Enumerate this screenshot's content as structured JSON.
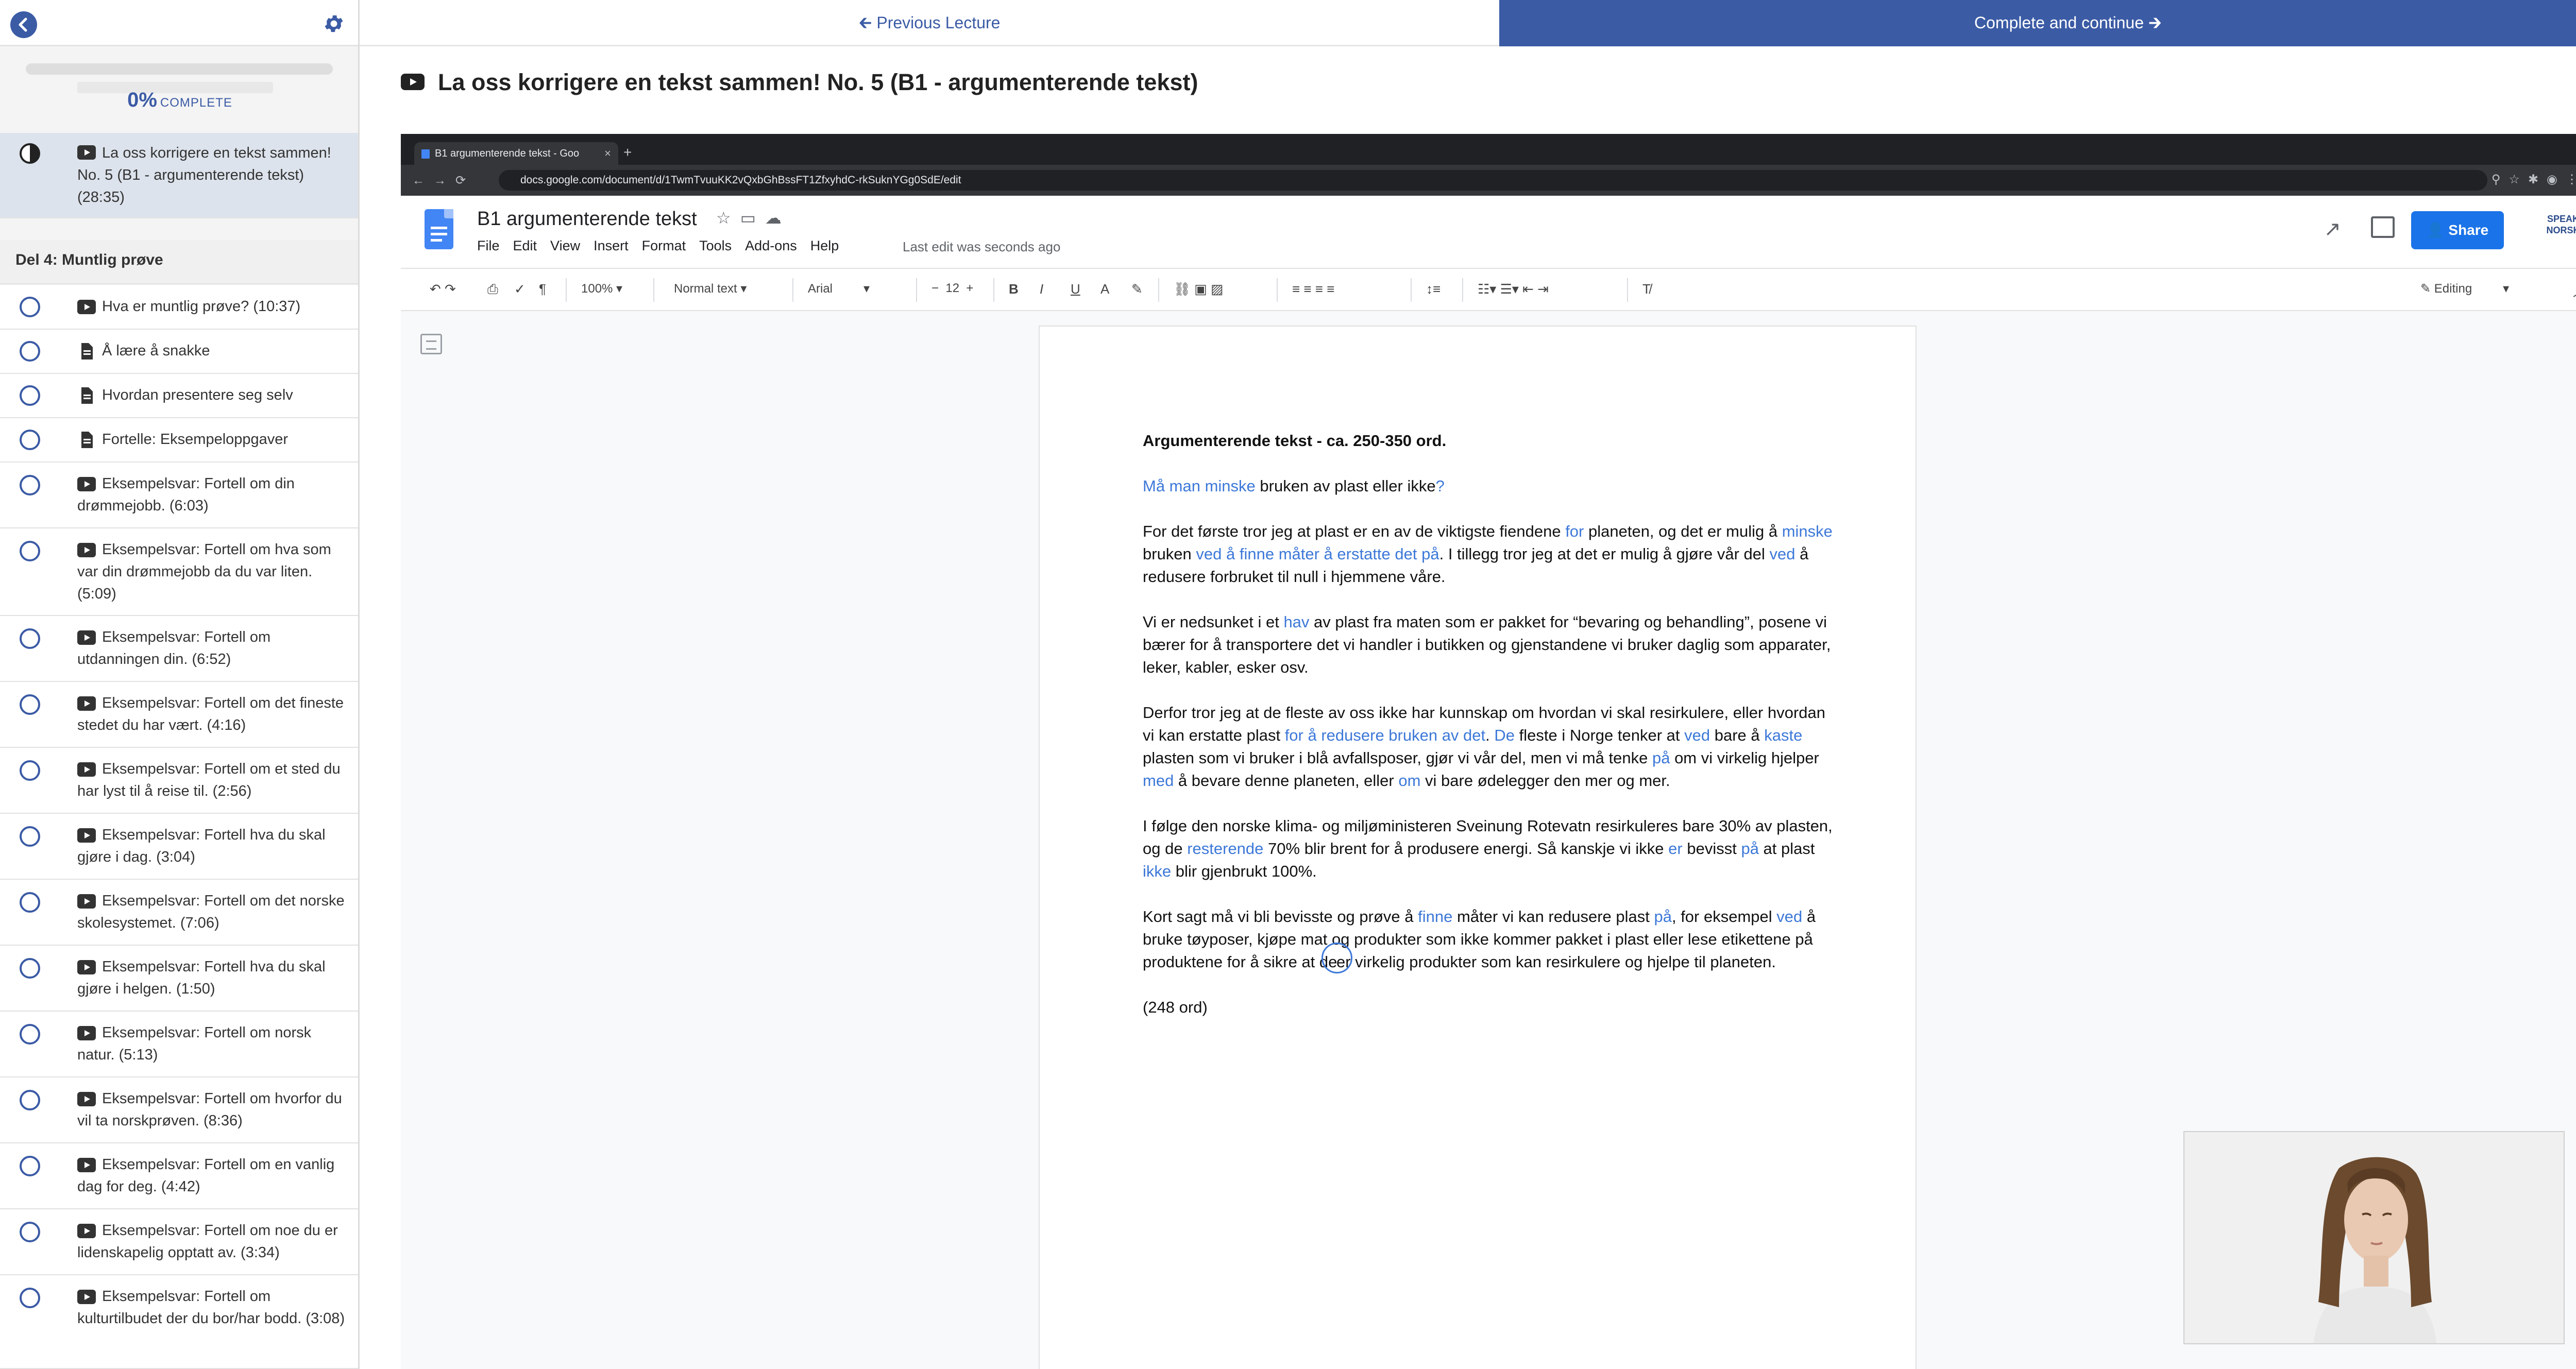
{
  "sidebar": {
    "progress_percent": 0,
    "progress_pct_text": "0%",
    "progress_complete_label": "COMPLETE",
    "current_item": {
      "label": "La oss korrigere en tekst sammen! No. 5 (B1 - argumenterende tekst) (28:35)",
      "icon": "video-icon"
    },
    "section_title": "Del 4: Muntlig prøve",
    "items": [
      {
        "label": "Hva er muntlig prøve? (10:37)",
        "icon": "video-icon"
      },
      {
        "label": "Å lære å snakke",
        "icon": "document-icon"
      },
      {
        "label": "Hvordan presentere seg selv",
        "icon": "document-icon"
      },
      {
        "label": "Fortelle: Eksempeloppgaver",
        "icon": "document-icon"
      },
      {
        "label": "Eksempelsvar: Fortell om din drømmejobb. (6:03)",
        "icon": "video-icon"
      },
      {
        "label": "Eksempelsvar: Fortell om hva som var din drømmejobb da du var liten. (5:09)",
        "icon": "video-icon"
      },
      {
        "label": "Eksempelsvar: Fortell om utdanningen din. (6:52)",
        "icon": "video-icon"
      },
      {
        "label": "Eksempelsvar: Fortell om det fineste stedet du har vært. (4:16)",
        "icon": "video-icon"
      },
      {
        "label": "Eksempelsvar: Fortell om et sted du har lyst til å reise til. (2:56)",
        "icon": "video-icon"
      },
      {
        "label": "Eksempelsvar: Fortell hva du skal gjøre i dag. (3:04)",
        "icon": "video-icon"
      },
      {
        "label": "Eksempelsvar: Fortell om det norske skolesystemet. (7:06)",
        "icon": "video-icon"
      },
      {
        "label": "Eksempelsvar: Fortell hva du skal gjøre i helgen. (1:50)",
        "icon": "video-icon"
      },
      {
        "label": "Eksempelsvar: Fortell om norsk natur. (5:13)",
        "icon": "video-icon"
      },
      {
        "label": "Eksempelsvar: Fortell om hvorfor du vil ta norskprøven. (8:36)",
        "icon": "video-icon"
      },
      {
        "label": "Eksempelsvar: Fortell om en vanlig dag for deg. (4:42)",
        "icon": "video-icon"
      },
      {
        "label": "Eksempelsvar: Fortell om noe du er lidenskapelig opptatt av. (3:34)",
        "icon": "video-icon"
      },
      {
        "label": "Eksempelsvar: Fortell om kulturtilbudet der du bor/har bodd. (3:08)",
        "icon": "video-icon"
      }
    ]
  },
  "topbar": {
    "prev_label": "Previous Lecture",
    "next_label": "Complete and continue"
  },
  "lecture": {
    "title": "La oss korrigere en tekst sammen! No. 5 (B1 - argumenterende tekst)"
  },
  "video": {
    "browser": {
      "tab_title": "B1 argumenterende tekst - Goo",
      "url": "docs.google.com/document/d/1TwmTvuuKK2vQxbGhBssFT1ZfxyhdC-rkSuknYGg0SdE/edit"
    },
    "docs": {
      "doc_title": "B1 argumenterende tekst",
      "menus": [
        "File",
        "Edit",
        "View",
        "Insert",
        "Format",
        "Tools",
        "Add-ons",
        "Help"
      ],
      "last_edit": "Last edit was seconds ago",
      "share_label": "Share",
      "avatar_text_1": "SPEAK",
      "avatar_text_2": "NORSK",
      "toolbar": {
        "zoom": "100%",
        "style": "Normal text",
        "font": "Arial",
        "font_size": "12",
        "mode": "Editing"
      }
    },
    "document": {
      "heading": "Argumenterende tekst - ca. 250-350 ord.",
      "question_blue": "Må man minske",
      "question_rest": " bruken av plast eller ikke",
      "question_mark": "?",
      "p1_a": "For det første tror jeg at plast er en av de viktigste fiendene ",
      "p1_b": "for",
      "p1_c": " planeten, og det er mulig å ",
      "p1_d": "minske",
      "p1_e": " bruken ",
      "p1_f": "ved å finne måter å erstatte det på",
      "p1_g": ". I tillegg tror jeg at det er mulig å gjøre vår del ",
      "p1_h": "ved",
      "p1_i": " å redusere forbruket til null i hjemmene våre.",
      "p2_a": "Vi er nedsunket i et ",
      "p2_b": "hav",
      "p2_c": " av plast fra maten som er pakket for “bevaring og behandling”, posene vi bærer for å transportere det vi handler i butikken og gjenstandene vi bruker daglig som apparater, leker, kabler, esker osv.",
      "p3_a": "Derfor tror jeg at de fleste av oss ikke har kunnskap om hvordan vi skal resirkulere, eller hvordan vi kan erstatte plast ",
      "p3_b": "for å redusere bruken av det",
      "p3_c": ". ",
      "p3_d": "De",
      "p3_e": " fleste i Norge tenker at ",
      "p3_f": "ved",
      "p3_g": " bare å ",
      "p3_h": "kaste",
      "p3_i": " plasten som vi bruker i blå avfallsposer, gjør vi vår del, men vi må tenke ",
      "p3_j": "på",
      "p3_k": " om vi virkelig hjelper ",
      "p3_l": "med",
      "p3_m": " å bevare denne planeten, eller ",
      "p3_n": "om",
      "p3_o": " vi bare ødelegger den mer og mer.",
      "p4_a": "I følge den norske klima- og miljøministeren Sveinung Rotevatn resirkuleres bare 30% av plasten, og de ",
      "p4_b": "resterende",
      "p4_c": " 70% blir brent for å produsere energi. Så kanskje vi ikke ",
      "p4_d": "er",
      "p4_e": " bevisst ",
      "p4_f": "på",
      "p4_g": " at plast ",
      "p4_h": "ikke",
      "p4_i": " blir gjenbrukt 100%.",
      "p5_a": "Kort sagt må vi bli bevisste og prøve å ",
      "p5_b": "finne",
      "p5_c": " måter vi kan redusere plast ",
      "p5_d": "på",
      "p5_e": ", for eksempel ",
      "p5_f": "ved",
      "p5_g": " å bruke tøyposer, kjøpe mat og produkter som ikke kommer pakket i plast eller lese etikettene på produktene for å sikre at de",
      "p5_h": " er virkelig produkter som kan resirkulere og hjelpe til planeten.",
      "word_count": "(248 ord)"
    }
  },
  "colors": {
    "brand": "#3b5ba5",
    "docs_blue": "#1a73e8",
    "correction_blue": "#3c78d8"
  }
}
